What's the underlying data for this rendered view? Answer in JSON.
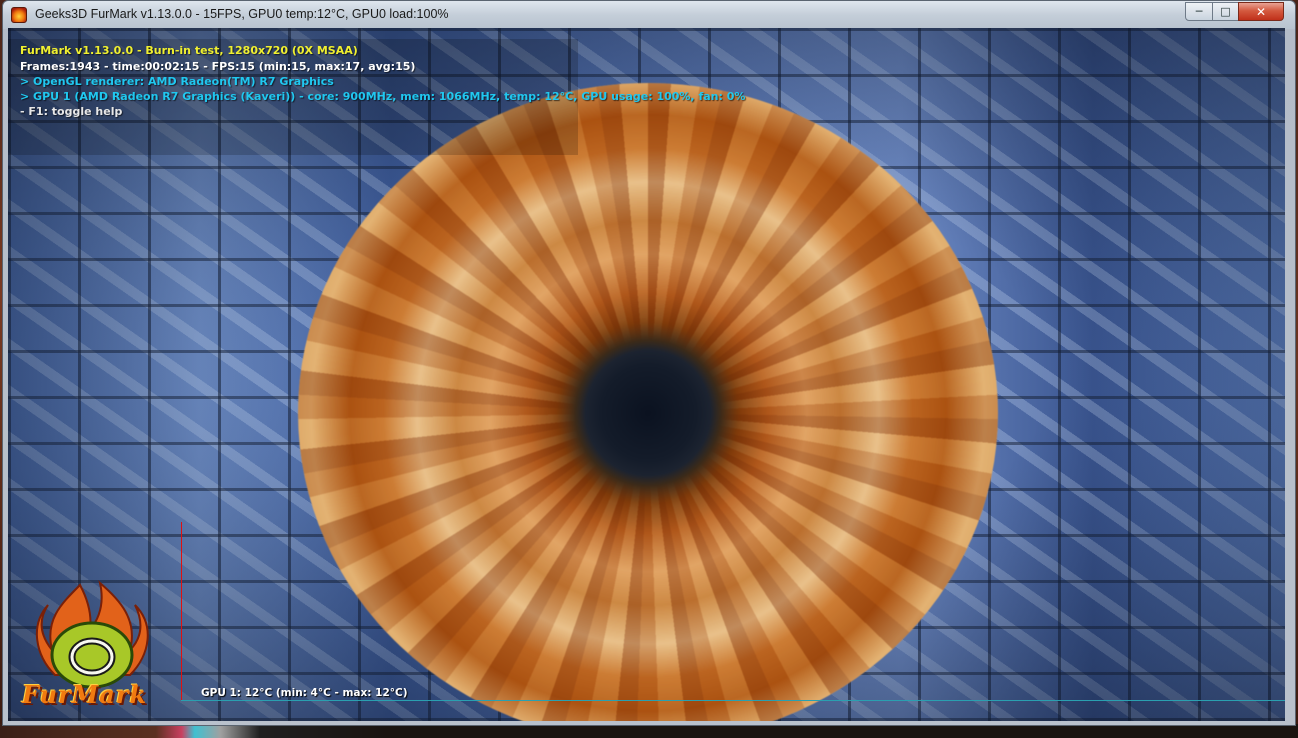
{
  "window": {
    "title": "Geeks3D FurMark v1.13.0.0 - 15FPS, GPU0 temp:12°C, GPU0 load:100%",
    "controls": {
      "minimize": "─",
      "maximize": "□",
      "close": "✕"
    }
  },
  "hud": {
    "line1": "FurMark v1.13.0.0 - Burn-in test, 1280x720 (0X MSAA)",
    "line2": "Frames:1943 - time:00:02:15 - FPS:15 (min:15, max:17, avg:15)",
    "line3": "> OpenGL renderer: AMD Radeon(TM) R7 Graphics",
    "line4": "> GPU 1 (AMD Radeon R7 Graphics (Kaveri)) - core: 900MHz, mem: 1066MHz, temp: 12°C, GPU usage: 100%, fan: 0%",
    "line5": "- F1: toggle help"
  },
  "graph": {
    "label": "GPU 1: 12°C (min: 4°C - max: 12°C)"
  },
  "logo": {
    "text": "FurMark"
  },
  "colors": {
    "hud_yellow": "#f0f030",
    "hud_cyan": "#20c8f0",
    "graph_axis": "#e01010",
    "graph_baseline": "#2aa0b0"
  },
  "icons": [
    "furmark-app-icon",
    "minimize-icon",
    "maximize-icon",
    "close-icon",
    "furmark-logo"
  ]
}
